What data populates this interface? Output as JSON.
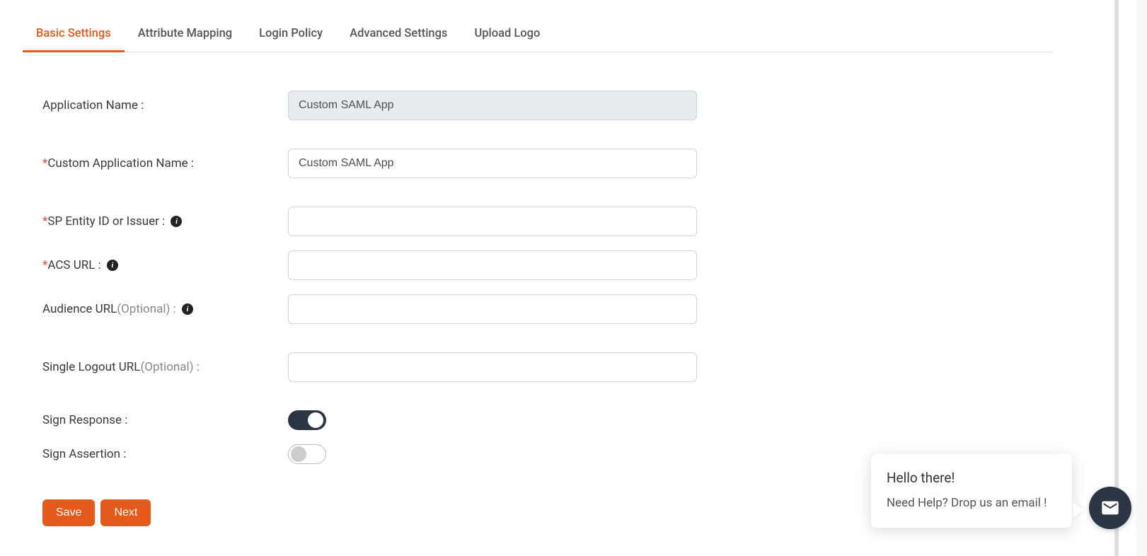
{
  "tabs": [
    {
      "label": "Basic Settings",
      "active": true
    },
    {
      "label": "Attribute Mapping",
      "active": false
    },
    {
      "label": "Login Policy",
      "active": false
    },
    {
      "label": "Advanced Settings",
      "active": false
    },
    {
      "label": "Upload Logo",
      "active": false
    }
  ],
  "form": {
    "app_name": {
      "label": "Application Name :",
      "value": "Custom SAML App"
    },
    "custom_app_name": {
      "label": "Custom Application Name :",
      "value": "Custom SAML App"
    },
    "sp_entity": {
      "label": "SP Entity ID or Issuer :",
      "value": ""
    },
    "acs_url": {
      "label": "ACS URL :",
      "value": ""
    },
    "audience_url": {
      "label_main": "Audience URL ",
      "label_opt": "(Optional) :",
      "value": ""
    },
    "slo_url": {
      "label_main": "Single Logout URL ",
      "label_opt": "(Optional) :",
      "value": ""
    },
    "sign_response": {
      "label": "Sign Response :",
      "value": true
    },
    "sign_assertion": {
      "label": "Sign Assertion :",
      "value": false
    }
  },
  "buttons": {
    "save": "Save",
    "next": "Next"
  },
  "chat": {
    "greeting": "Hello there!",
    "msg": "Need Help? Drop us an email !"
  },
  "required_marker": "*",
  "info_glyph": "i"
}
